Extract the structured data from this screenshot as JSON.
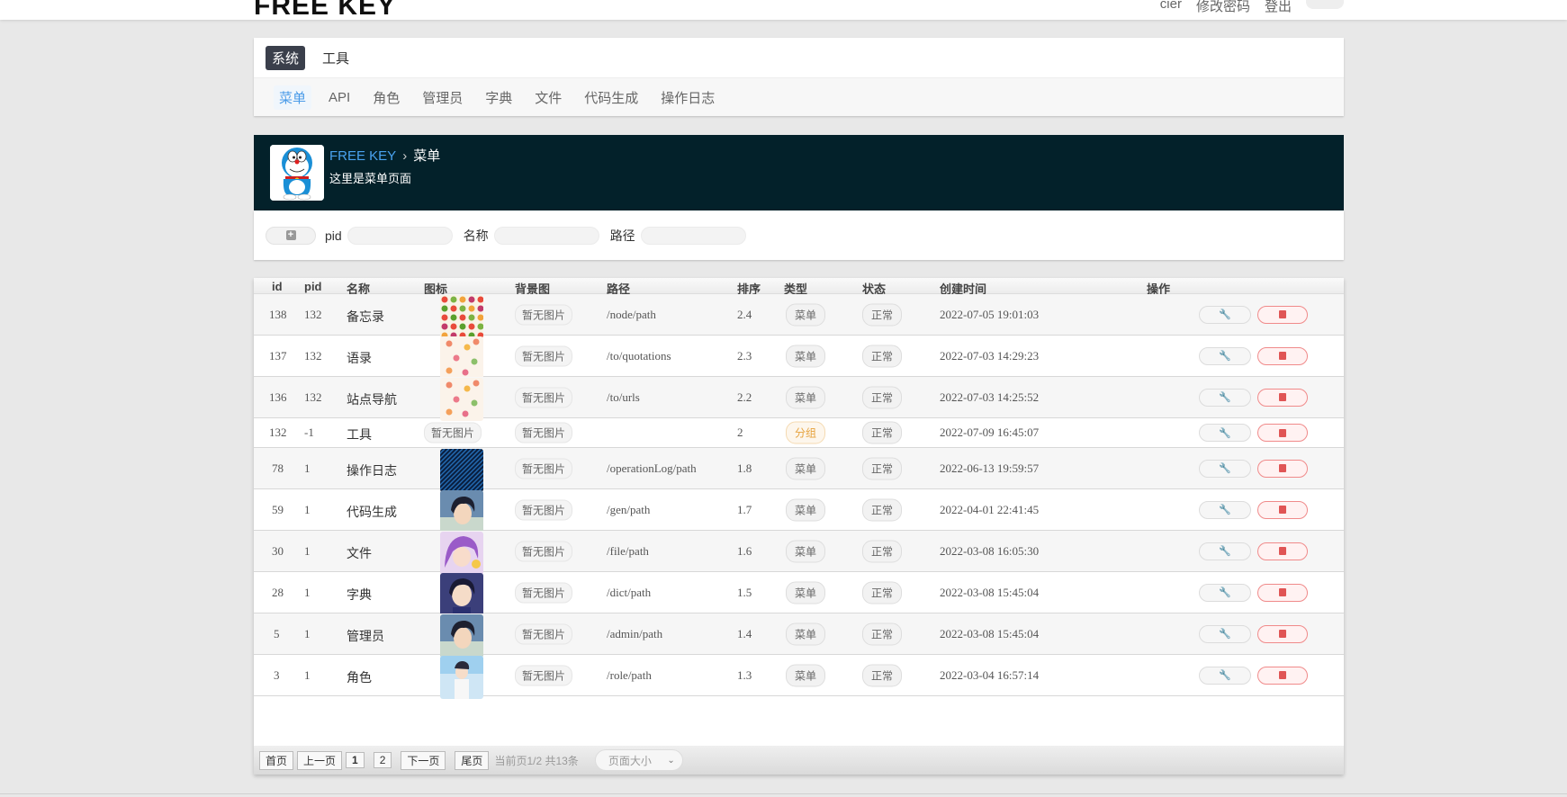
{
  "header": {
    "brand": "FREE KEY",
    "links": [
      "cier",
      "修改密码",
      "登出"
    ]
  },
  "nav": {
    "tabs": [
      {
        "label": "系统",
        "active": true
      },
      {
        "label": "工具",
        "active": false
      }
    ],
    "subtabs": [
      {
        "label": "菜单",
        "active": true
      },
      {
        "label": "API",
        "active": false
      },
      {
        "label": "角色",
        "active": false
      },
      {
        "label": "管理员",
        "active": false
      },
      {
        "label": "字典",
        "active": false
      },
      {
        "label": "文件",
        "active": false
      },
      {
        "label": "代码生成",
        "active": false
      },
      {
        "label": "操作日志",
        "active": false
      }
    ]
  },
  "banner": {
    "home": "FREE KEY",
    "separator": "›",
    "current": "菜单",
    "description": "这里是菜单页面"
  },
  "filter": {
    "add_icon": "plus-square-icon",
    "labels": {
      "pid": "pid",
      "name": "名称",
      "path": "路径"
    }
  },
  "table": {
    "columns": [
      "id",
      "pid",
      "名称",
      "图标",
      "背景图",
      "路径",
      "排序",
      "类型",
      "状态",
      "创建时间",
      "操作"
    ],
    "no_image": "暂无图片",
    "rows": [
      {
        "id": "138",
        "pid": "132",
        "name": "备忘录",
        "icon": "fruit",
        "bg": "暂无图片",
        "path": "/node/path",
        "sort": "2.4",
        "type": "菜单",
        "status": "正常",
        "created": "2022-07-05 19:01:03"
      },
      {
        "id": "137",
        "pid": "132",
        "name": "语录",
        "icon": "flower",
        "bg": "暂无图片",
        "path": "/to/quotations",
        "sort": "2.3",
        "type": "菜单",
        "status": "正常",
        "created": "2022-07-03 14:29:23"
      },
      {
        "id": "136",
        "pid": "132",
        "name": "站点导航",
        "icon": "flower",
        "bg": "暂无图片",
        "path": "/to/urls",
        "sort": "2.2",
        "type": "菜单",
        "status": "正常",
        "created": "2022-07-03 14:25:52"
      },
      {
        "id": "132",
        "pid": "-1",
        "name": "工具",
        "icon": "none",
        "bg": "暂无图片",
        "path": "",
        "sort": "2",
        "type": "分组",
        "status": "正常",
        "created": "2022-07-09 16:45:07"
      },
      {
        "id": "78",
        "pid": "1",
        "name": "操作日志",
        "icon": "blue",
        "bg": "暂无图片",
        "path": "/operationLog/path",
        "sort": "1.8",
        "type": "菜单",
        "status": "正常",
        "created": "2022-06-13 19:59:57"
      },
      {
        "id": "59",
        "pid": "1",
        "name": "代码生成",
        "icon": "person",
        "bg": "暂无图片",
        "path": "/gen/path",
        "sort": "1.7",
        "type": "菜单",
        "status": "正常",
        "created": "2022-04-01 22:41:45"
      },
      {
        "id": "30",
        "pid": "1",
        "name": "文件",
        "icon": "anime-pink",
        "bg": "暂无图片",
        "path": "/file/path",
        "sort": "1.6",
        "type": "菜单",
        "status": "正常",
        "created": "2022-03-08 16:05:30"
      },
      {
        "id": "28",
        "pid": "1",
        "name": "字典",
        "icon": "anime-dark",
        "bg": "暂无图片",
        "path": "/dict/path",
        "sort": "1.5",
        "type": "菜单",
        "status": "正常",
        "created": "2022-03-08 15:45:04"
      },
      {
        "id": "5",
        "pid": "1",
        "name": "管理员",
        "icon": "person",
        "bg": "暂无图片",
        "path": "/admin/path",
        "sort": "1.4",
        "type": "菜单",
        "status": "正常",
        "created": "2022-03-08 15:45:04"
      },
      {
        "id": "3",
        "pid": "1",
        "name": "角色",
        "icon": "anime-light",
        "bg": "暂无图片",
        "path": "/role/path",
        "sort": "1.3",
        "type": "菜单",
        "status": "正常",
        "created": "2022-03-04 16:57:14"
      }
    ]
  },
  "pagination": {
    "first": "首页",
    "prev": "上一页",
    "pages": [
      "1",
      "2"
    ],
    "current": "1",
    "next": "下一页",
    "last": "尾页",
    "info": "当前页1/2 共13条",
    "page_size_placeholder": "页面大小"
  }
}
